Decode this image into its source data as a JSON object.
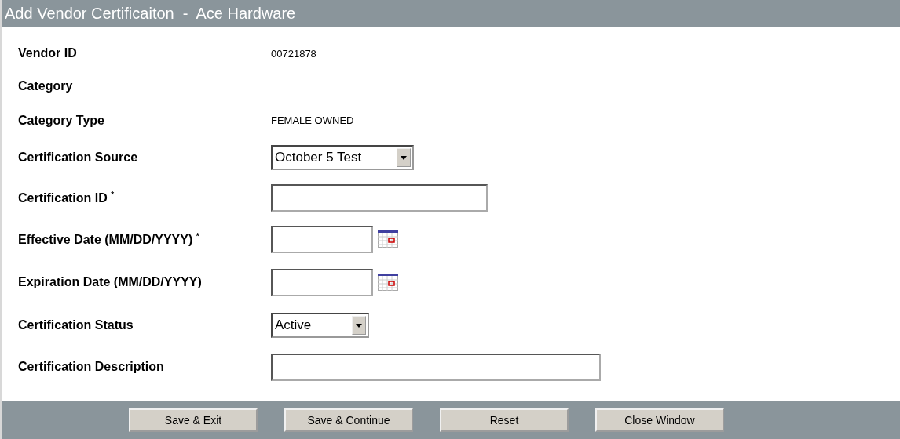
{
  "window": {
    "title": "Add Vendor Certificaiton  -  Ace Hardware"
  },
  "fields": [
    {
      "kind": "text",
      "label": "Vendor ID",
      "value": "00721878"
    },
    {
      "kind": "text",
      "label": "Category"
    },
    {
      "kind": "text",
      "label": "Category Type",
      "value": "FEMALE OWNED"
    },
    {
      "kind": "select",
      "label": "Certification Source",
      "value": "October 5 Test"
    },
    {
      "kind": "input",
      "label": "Certification ID $^{*}$"
    },
    {
      "kind": "date",
      "label": "Effective Date (MM/DD/YYYY) $^{*}$"
    },
    {
      "kind": "date",
      "label": "Expiration Date (MM/DD/YYYY)"
    },
    {
      "kind": "select",
      "label": "Certification Status",
      "value": "Active"
    },
    {
      "kind": "input",
      "label": "Certification Description"
    }
  ],
  "buttons": [
    "Save & Exit",
    "Save & Continue",
    "Reset",
    "Close Window"
  ]
}
